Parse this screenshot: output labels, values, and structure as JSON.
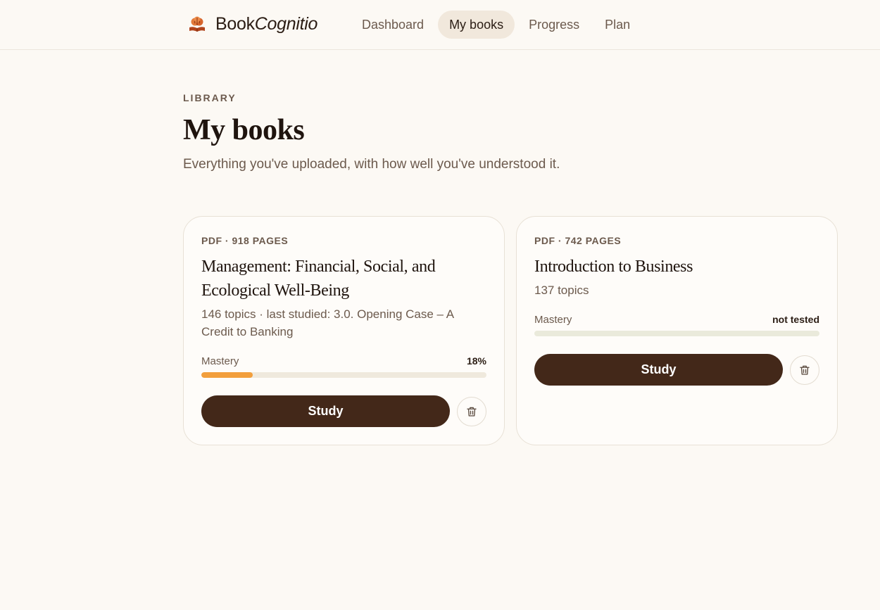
{
  "brand": {
    "name_plain": "Book",
    "name_italic": "Cognitio"
  },
  "nav": [
    {
      "label": "Dashboard",
      "active": false
    },
    {
      "label": "My books",
      "active": true
    },
    {
      "label": "Progress",
      "active": false
    },
    {
      "label": "Plan",
      "active": false
    }
  ],
  "header": {
    "eyebrow": "LIBRARY",
    "title": "My books",
    "subtitle": "Everything you've uploaded, with how well you've understood it."
  },
  "books": [
    {
      "meta": "PDF · 918 PAGES",
      "title": "Management: Financial, Social, and Ecological Well-Being",
      "subtitle": "146 topics · last studied: 3.0. Opening Case – A Credit to Banking",
      "mastery_label": "Mastery",
      "mastery_value": "18%",
      "mastery_percent": 18,
      "study_label": "Study"
    },
    {
      "meta": "PDF · 742 PAGES",
      "title": "Introduction to Business",
      "subtitle": "137 topics",
      "mastery_label": "Mastery",
      "mastery_value": "not tested",
      "mastery_percent": 0,
      "study_label": "Study"
    }
  ],
  "colors": {
    "accent_dark": "#432819",
    "progress_fill": "#f29f3d",
    "active_nav_bg": "#f1e8dc",
    "background": "#fcf9f4"
  },
  "icons": {
    "logo": "brain-book-icon",
    "delete": "trash-icon"
  }
}
